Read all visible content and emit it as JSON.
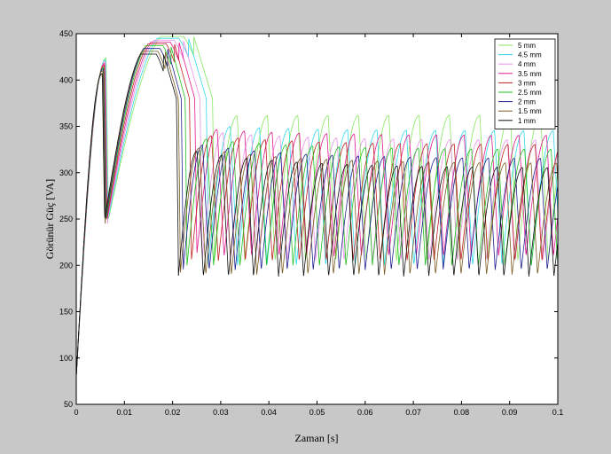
{
  "chart_data": {
    "type": "line",
    "xlabel": "Zaman [s]",
    "ylabel": "Görünür Güç [VA]",
    "xlim": [
      0,
      0.1
    ],
    "ylim": [
      50,
      450
    ],
    "xticks": [
      "0",
      "0.01",
      "0.02",
      "0.03",
      "0.04",
      "0.05",
      "0.06",
      "0.07",
      "0.08",
      "0.09",
      "0.1"
    ],
    "yticks": [
      "50",
      "100",
      "150",
      "200",
      "250",
      "300",
      "350",
      "400",
      "450"
    ],
    "grid": false,
    "legend_position": "top-right",
    "series": [
      {
        "name": "5 mm",
        "color": "#88e860",
        "peak1": 424,
        "t1": 0.0062,
        "peak2": 447,
        "t2": 0.0283,
        "steady_high": 362,
        "steady_low": 205,
        "period": 0.0063
      },
      {
        "name": "4.5 mm",
        "color": "#30d8e8",
        "peak1": 422,
        "t1": 0.0061,
        "peak2": 445,
        "t2": 0.027,
        "steady_high": 345,
        "steady_low": 200,
        "period": 0.0061
      },
      {
        "name": "4 mm",
        "color": "#e890e8",
        "peak1": 420,
        "t1": 0.006,
        "peak2": 443,
        "t2": 0.0257,
        "steady_high": 335,
        "steady_low": 205,
        "period": 0.0059
      },
      {
        "name": "3.5 mm",
        "color": "#e01890",
        "peak1": 418,
        "t1": 0.0059,
        "peak2": 441,
        "t2": 0.0246,
        "steady_high": 340,
        "steady_low": 210,
        "period": 0.0057
      },
      {
        "name": "3 mm",
        "color": "#c02020",
        "peak1": 416,
        "t1": 0.0058,
        "peak2": 439,
        "t2": 0.0235,
        "steady_high": 330,
        "steady_low": 205,
        "period": 0.0056
      },
      {
        "name": "2.5 mm",
        "color": "#20c020",
        "peak1": 414,
        "t1": 0.0057,
        "peak2": 437,
        "t2": 0.0226,
        "steady_high": 325,
        "steady_low": 200,
        "period": 0.0055
      },
      {
        "name": "2 mm",
        "color": "#202090",
        "peak1": 412,
        "t1": 0.0056,
        "peak2": 434,
        "t2": 0.0218,
        "steady_high": 315,
        "steady_low": 195,
        "period": 0.0054
      },
      {
        "name": "1.5 mm",
        "color": "#7a5a20",
        "peak1": 410,
        "t1": 0.0055,
        "peak2": 431,
        "t2": 0.0212,
        "steady_high": 310,
        "steady_low": 190,
        "period": 0.0053
      },
      {
        "name": "1 mm",
        "color": "#101010",
        "peak1": 407,
        "t1": 0.0054,
        "peak2": 428,
        "t2": 0.0208,
        "steady_high": 305,
        "steady_low": 188,
        "period": 0.0052
      }
    ]
  }
}
